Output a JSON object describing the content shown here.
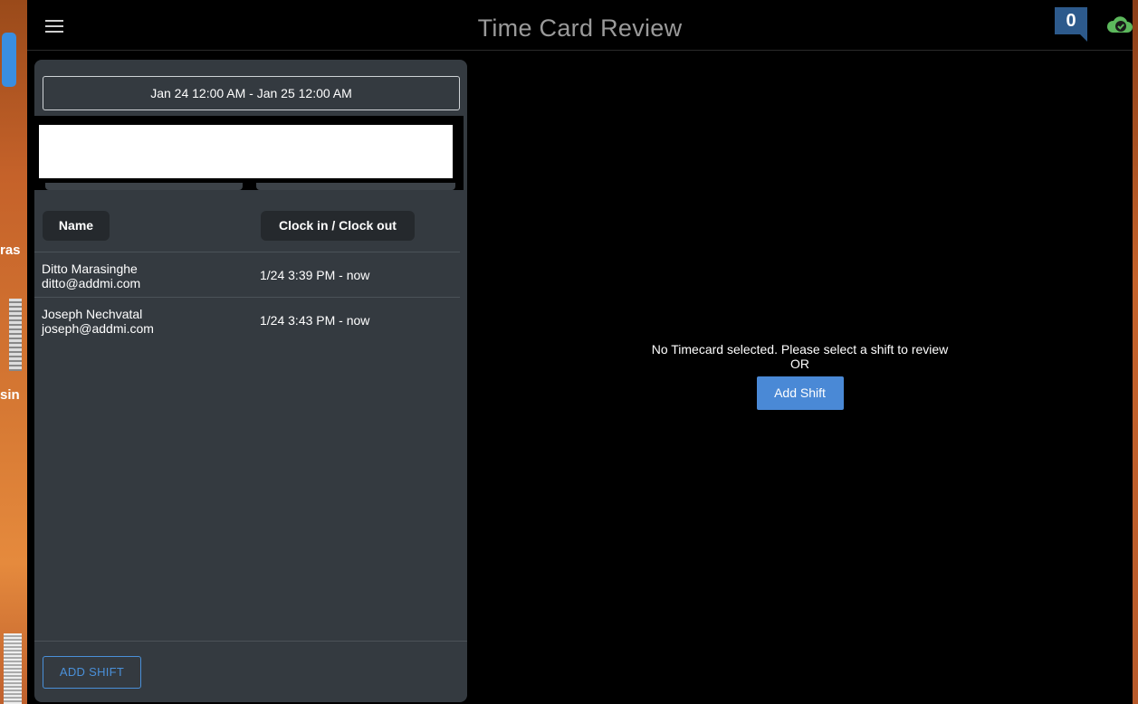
{
  "desktop": {
    "frag_1": "ras",
    "frag_2": "sin"
  },
  "header": {
    "title": "Time Card Review",
    "notification_count": "0",
    "icons": {
      "menu": "hamburger-menu-icon",
      "sync": "cloud-check-icon"
    },
    "colors": {
      "badge": "#2d5a8c",
      "sync": "#5cb85c"
    }
  },
  "filter": {
    "date_range": "Jan 24 12:00 AM - Jan 25 12:00 AM"
  },
  "table": {
    "columns": [
      "Name",
      "Clock in / Clock out"
    ],
    "rows": [
      {
        "name": "Ditto Marasinghe",
        "email": "ditto@addmi.com",
        "time": "1/24 3:39 PM - now"
      },
      {
        "name": "Joseph Nechvatal",
        "email": "joseph@addmi.com",
        "time": "1/24 3:43 PM - now"
      }
    ]
  },
  "footer": {
    "add_shift_label": "ADD SHIFT"
  },
  "empty_state": {
    "message": "No Timecard selected. Please select a shift to review",
    "or": "OR",
    "add_shift_label": "Add Shift"
  },
  "colors": {
    "panel": "#343a40",
    "accent": "#4a89d6"
  }
}
